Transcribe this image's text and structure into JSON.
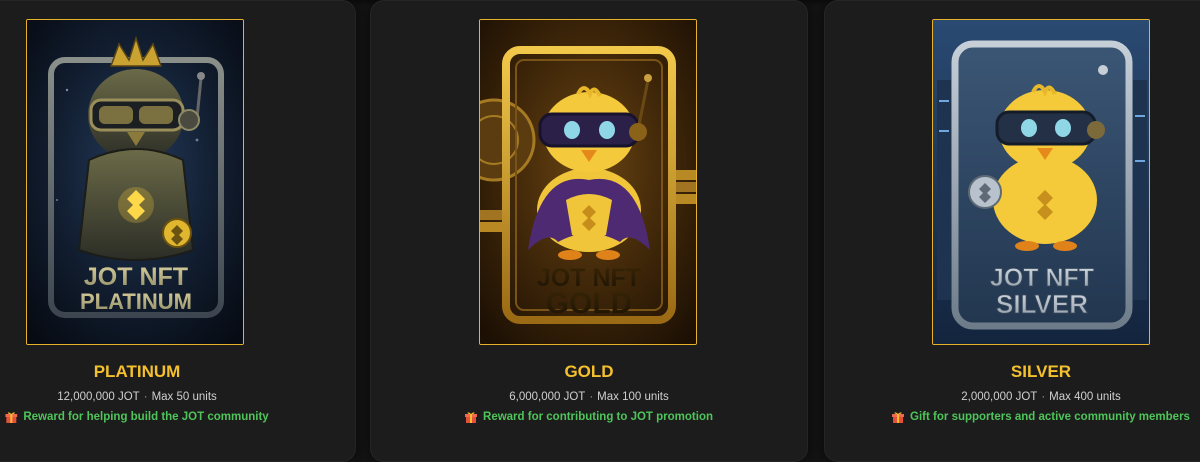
{
  "tiers": [
    {
      "title": "PLATINUM",
      "amount": "12,000,000 JOT",
      "separator": "·",
      "max": "Max 50 units",
      "reward": "Reward for helping build the JOT community",
      "art_line1": "JOT NFT",
      "art_line2": "PLATINUM",
      "icon": "gift-icon"
    },
    {
      "title": "GOLD",
      "amount": "6,000,000 JOT",
      "separator": "·",
      "max": "Max 100 units",
      "reward": "Reward for contributing to JOT promotion",
      "art_line1": "JOT NFT",
      "art_line2": "GOLD",
      "icon": "gift-icon"
    },
    {
      "title": "SILVER",
      "amount": "2,000,000 JOT",
      "separator": "·",
      "max": "Max 400 units",
      "reward": "Gift for supporters and active community members",
      "art_line1": "JOT NFT",
      "art_line2": "SILVER",
      "icon": "gift-icon"
    }
  ],
  "colors": {
    "accent_gold": "#f5c02e",
    "reward_green": "#4ec45a",
    "card_bg": "#1c1c1c",
    "page_bg": "#141414"
  }
}
